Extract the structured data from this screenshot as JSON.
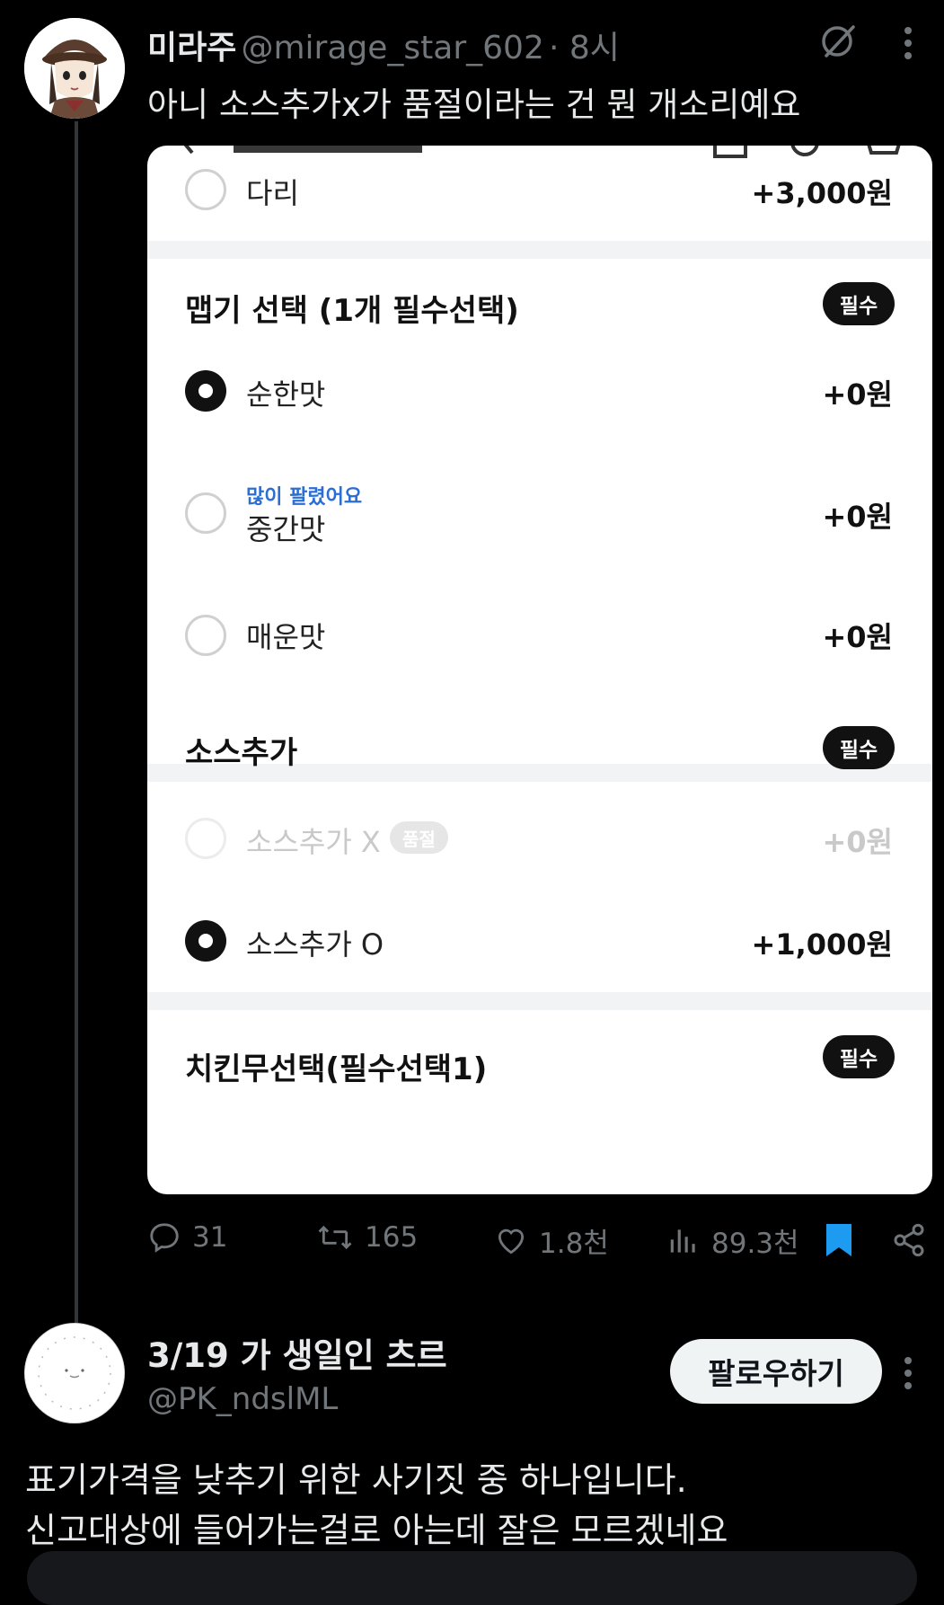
{
  "tweet": {
    "author_name": "미라주",
    "author_handle": "@mirage_star_602",
    "time": "· 8시",
    "text": "아니 소스추가x가 품절이라는 건 뭔 개소리예요",
    "stats": {
      "replies": "31",
      "retweets": "165",
      "likes": "1.8천",
      "views": "89.3천"
    }
  },
  "card": {
    "top_row": {
      "label": "다리",
      "price": "+3,000원"
    },
    "spice_section": {
      "title": "맵기 선택 (1개 필수선택)",
      "badge": "필수",
      "options": [
        {
          "label": "순한맛",
          "price": "+0원",
          "selected": true
        },
        {
          "label": "중간맛",
          "price": "+0원",
          "tag": "많이 팔렸어요",
          "selected": false
        },
        {
          "label": "매운맛",
          "price": "+0원",
          "selected": false
        }
      ]
    },
    "sauce_section": {
      "title": "소스추가",
      "badge": "필수",
      "options": [
        {
          "label": "소스추가 X",
          "price": "+0원",
          "soldout": "품절",
          "disabled": true
        },
        {
          "label": "소스추가 O",
          "price": "+1,000원",
          "selected": true
        }
      ]
    },
    "radish_section": {
      "title": "치킨무선택(필수선택1)",
      "badge": "필수"
    }
  },
  "reply": {
    "author_name": "3/19 가 생일인 츠르",
    "author_handle": "@PK_ndslML",
    "follow_label": "팔로우하기",
    "text_line1": "표기가격을 낮추기 위한 사기짓 중 하나입니다.",
    "text_line2": "신고대상에 들어가는걸로 아는데 잘은 모르겠네요"
  },
  "colors": {
    "background": "#000000",
    "text_primary": "#e7e9ea",
    "text_secondary": "#71767b",
    "bookmark_active": "#1d9bf0",
    "popular_tag": "#2b6fd6"
  }
}
